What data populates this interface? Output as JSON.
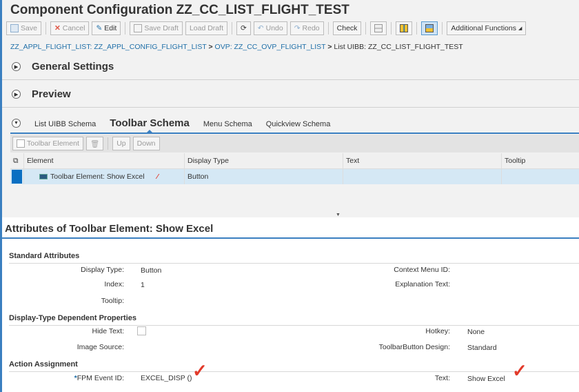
{
  "title": "Component Configuration ZZ_CC_LIST_FLIGHT_TEST",
  "toolbar": {
    "save": "Save",
    "cancel": "Cancel",
    "edit": "Edit",
    "save_draft": "Save Draft",
    "load_draft": "Load Draft",
    "undo": "Undo",
    "redo": "Redo",
    "check": "Check",
    "additional": "Additional Functions"
  },
  "breadcrumb": {
    "part1": "ZZ_APPL_FLIGHT_LIST: ZZ_APPL_CONFIG_FLIGHT_LIST",
    "sep": ">",
    "part2": "OVP: ZZ_CC_OVP_FLIGHT_LIST",
    "part3": "List UIBB: ZZ_CC_LIST_FLIGHT_TEST"
  },
  "sections": {
    "general": "General Settings",
    "preview": "Preview"
  },
  "tabs": [
    "List UIBB Schema",
    "Toolbar Schema",
    "Menu Schema",
    "Quickview Schema"
  ],
  "schema_toolbar": {
    "add": "Toolbar Element",
    "up": "Up",
    "down": "Down"
  },
  "table": {
    "columns": [
      "Element",
      "Display Type",
      "Text",
      "Tooltip"
    ],
    "rows": [
      {
        "element": "Toolbar Element: Show Excel",
        "display_type": "Button",
        "text": "",
        "tooltip": ""
      }
    ]
  },
  "attributes": {
    "title": "Attributes of Toolbar Element: Show Excel",
    "standard": {
      "heading": "Standard Attributes",
      "display_type_label": "Display Type:",
      "display_type": "Button",
      "index_label": "Index:",
      "index": "1",
      "tooltip_label": "Tooltip:",
      "context_menu_label": "Context Menu ID:",
      "explanation_label": "Explanation Text:"
    },
    "dependent": {
      "heading": "Display-Type Dependent Properties",
      "hide_text_label": "Hide Text:",
      "hide_text": false,
      "image_source_label": "Image Source:",
      "hotkey_label": "Hotkey:",
      "hotkey": "None",
      "design_label": "ToolbarButton Design:",
      "design": "Standard"
    },
    "action": {
      "heading": "Action Assignment",
      "required": "*",
      "event_label": "FPM Event ID:",
      "event": "EXCEL_DISP ()",
      "text_label": "Text:",
      "text": "Show Excel"
    }
  },
  "colors": {
    "accent": "#3a7fc0",
    "selected_row": "#d5e8f5",
    "annotation": "#e23a2a"
  }
}
